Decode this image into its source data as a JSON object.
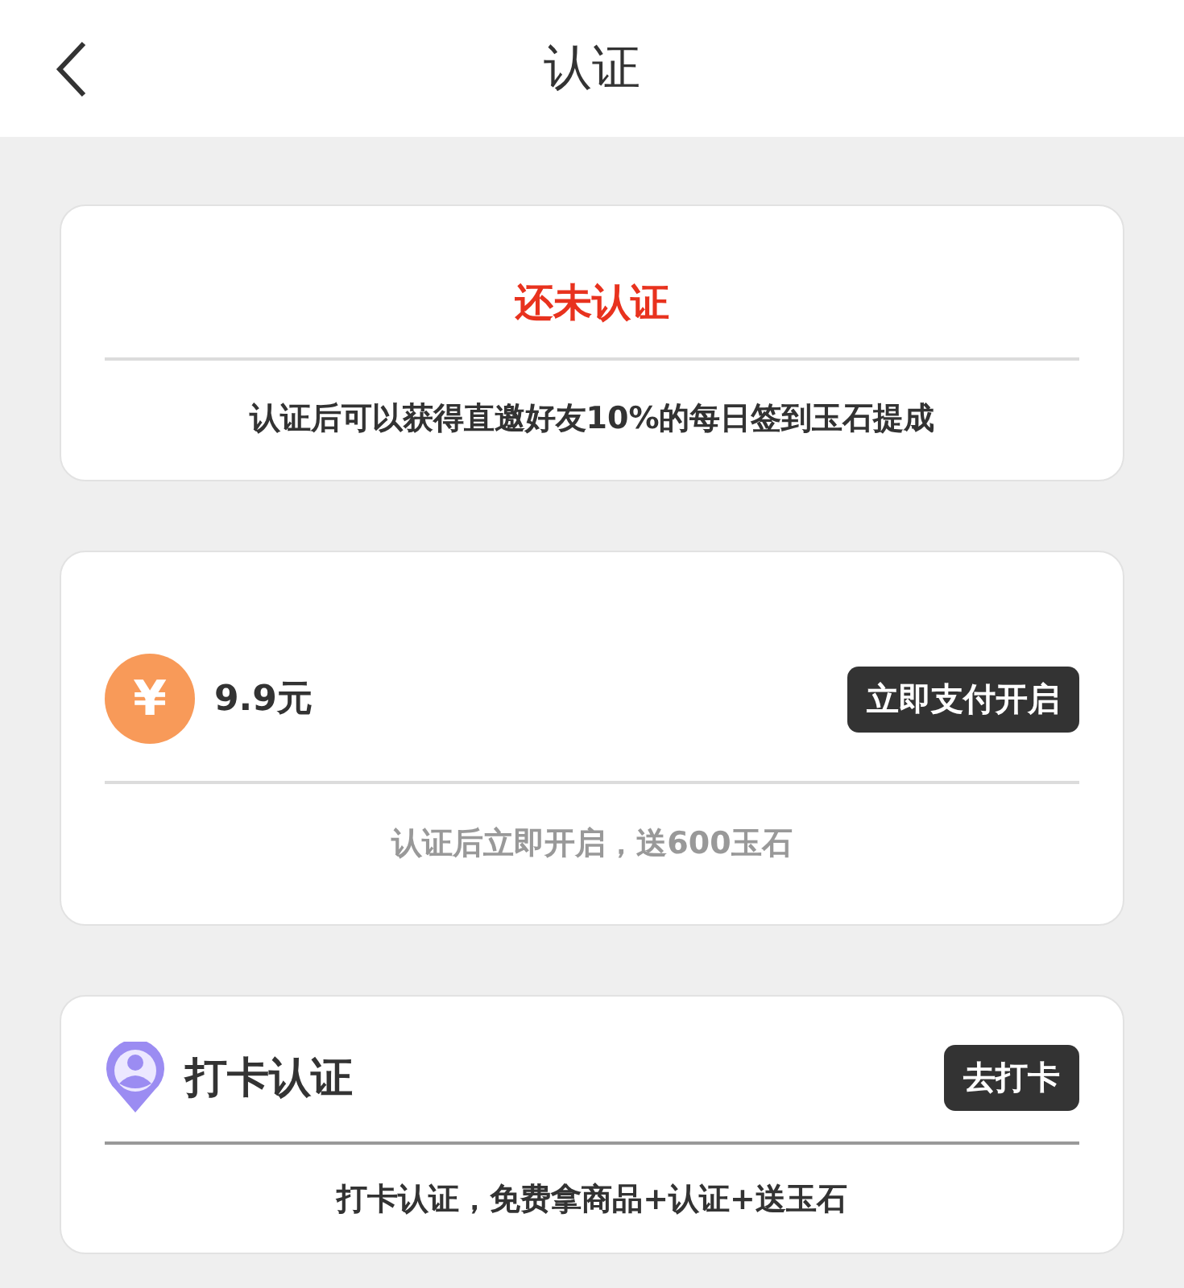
{
  "header": {
    "title": "认证"
  },
  "status_card": {
    "status": "还未认证",
    "note": "认证后可以获得直邀好友10%的每日签到玉石提成"
  },
  "options": [
    {
      "kind": "pay",
      "glyph": "¥",
      "label": "9.9元",
      "button": "立即支付开启",
      "note": "认证后立即开启，送600玉石"
    },
    {
      "kind": "checkin",
      "label": "打卡认证",
      "button": "去打卡",
      "note": "打卡认证，免费拿商品+认证+送玉石"
    }
  ]
}
